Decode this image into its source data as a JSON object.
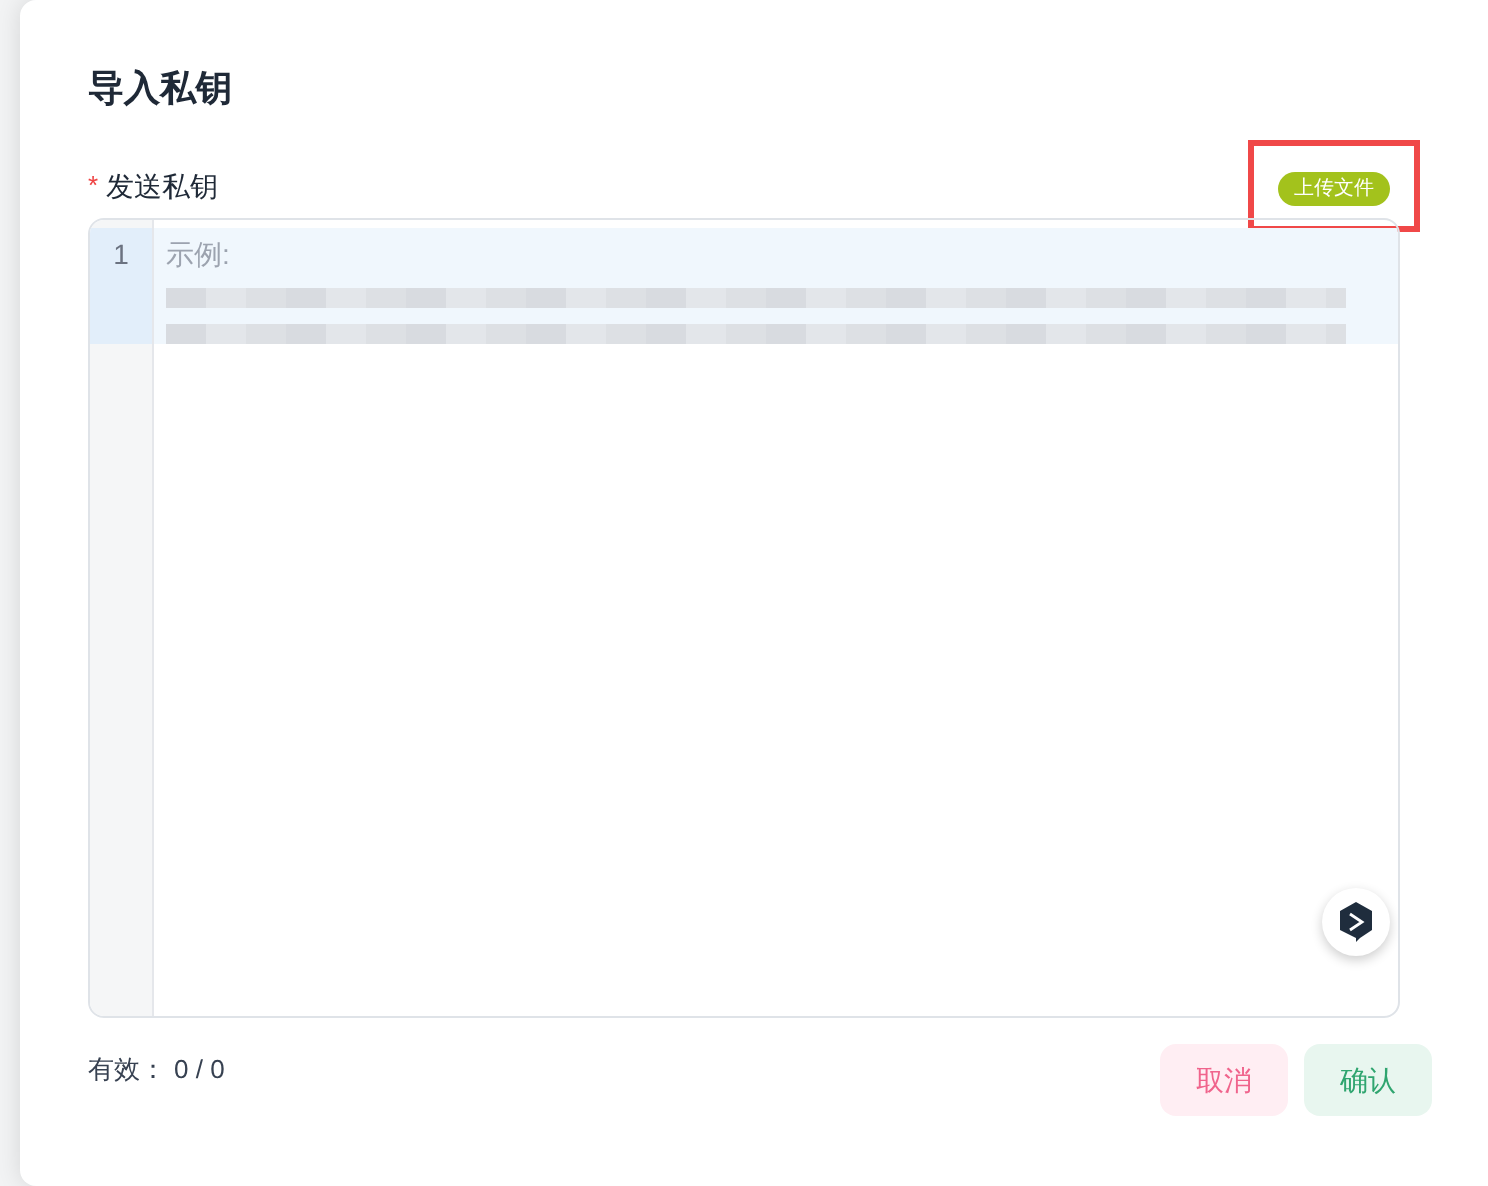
{
  "dialog": {
    "title": "导入私钥"
  },
  "field": {
    "label": "发送私钥",
    "required_mark": "*",
    "upload_button": {
      "label": "上传文件",
      "highlighted": true
    }
  },
  "editor": {
    "lines": [
      {
        "number": "1",
        "text": "示例:",
        "active": true
      }
    ]
  },
  "valid_count": {
    "label": "有效：",
    "value": "0 / 0"
  },
  "buttons": [
    {
      "label": "取消",
      "kind": "cancel"
    },
    {
      "label": "确认",
      "kind": "confirm"
    }
  ]
}
